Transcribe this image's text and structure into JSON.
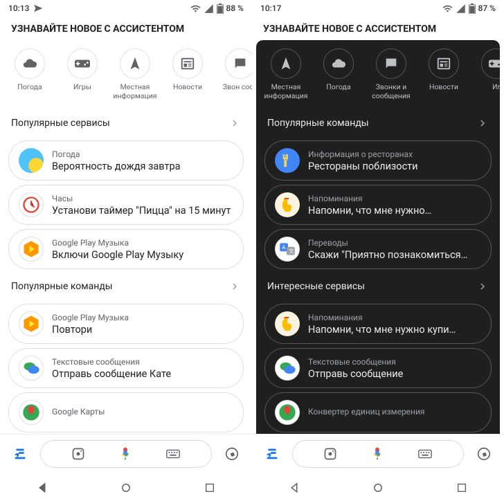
{
  "left": {
    "status": {
      "time": "10:13",
      "battery": "88 %"
    },
    "header": "УЗНАВАЙТЕ НОВОЕ С АССИСТЕНТОМ",
    "chips": [
      {
        "label": "Погода",
        "icon": "cloud"
      },
      {
        "label": "Игры",
        "icon": "gamepad"
      },
      {
        "label": "Местная информация",
        "icon": "nav"
      },
      {
        "label": "Новости",
        "icon": "news"
      },
      {
        "label": "Звон сооб",
        "icon": "chat"
      }
    ],
    "section1": "Популярные сервисы",
    "cards1": [
      {
        "sub": "Погода",
        "main": "Вероятность дождя завтра",
        "badgeClass": "bg-grad-weather",
        "glyph": ""
      },
      {
        "sub": "Часы",
        "main": "Установи таймер \"Пицца\" на 15 минут",
        "badgeClass": "bg-white",
        "glyph": "clock-red"
      },
      {
        "sub": "Google Play Музыка",
        "main": "Включи Google Play Музыку",
        "badgeClass": "bg-white",
        "glyph": "play-music"
      }
    ],
    "section2": "Популярные команды",
    "cards2": [
      {
        "sub": "Google Play Музыка",
        "main": "Повтори",
        "badgeClass": "bg-white",
        "glyph": "play-music"
      },
      {
        "sub": "Текстовые сообщения",
        "main": "Отправь сообщение Кате",
        "badgeClass": "bg-white",
        "glyph": "messages"
      },
      {
        "sub": "Google Карты",
        "main": "",
        "badgeClass": "bg-white",
        "glyph": "maps"
      }
    ]
  },
  "right": {
    "status": {
      "time": "10:17",
      "battery": "87 %"
    },
    "header": "УЗНАВАЙТЕ НОВОЕ С АССИСТЕНТОМ",
    "chips": [
      {
        "label": "Местная информация",
        "icon": "nav"
      },
      {
        "label": "Погода",
        "icon": "cloud"
      },
      {
        "label": "Звонки и сообщения",
        "icon": "chat"
      },
      {
        "label": "Новости",
        "icon": "news"
      },
      {
        "label": "Иг",
        "icon": "gamepad"
      }
    ],
    "section1": "Популярные команды",
    "cards1": [
      {
        "sub": "Информация о ресторанах",
        "main": "Рестораны поблизости",
        "badgeClass": "bg-blue",
        "glyph": "fork"
      },
      {
        "sub": "Напоминания",
        "main": "Напомни, что мне нужно…",
        "badgeClass": "bg-cream",
        "glyph": "finger"
      },
      {
        "sub": "Переводы",
        "main": "Скажи \"Приятно познакомиться…",
        "badgeClass": "bg-white",
        "glyph": "translate"
      }
    ],
    "section2": "Интересные сервисы",
    "cards2": [
      {
        "sub": "Напоминания",
        "main": "Напомни, что мне нужно купи…",
        "badgeClass": "bg-cream",
        "glyph": "finger"
      },
      {
        "sub": "Текстовые сообщения",
        "main": "Отправь сообщение",
        "badgeClass": "bg-white",
        "glyph": "messages"
      },
      {
        "sub": "Конвертер единиц измерения",
        "main": "",
        "badgeClass": "bg-white",
        "glyph": "maps"
      }
    ]
  }
}
